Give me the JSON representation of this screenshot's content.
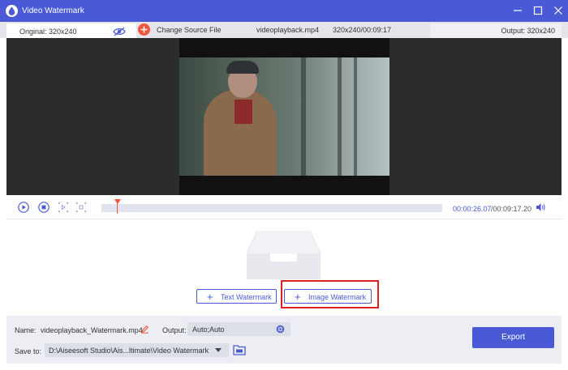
{
  "window": {
    "title": "Video Watermark",
    "controls": [
      "minimize-icon",
      "maximize-icon",
      "close-icon"
    ]
  },
  "infobar": {
    "original": "Original: 320x240",
    "change_source": "Change Source File",
    "filename": "videoplayback.mp4",
    "resolution_duration": "320x240/00:09:17",
    "output": "Output: 320x240"
  },
  "player": {
    "current_time": "00:00:26.07",
    "total_time": "/00:09:17.20",
    "progress_fraction": 0.047,
    "icons": [
      "play-icon",
      "stop-icon",
      "clip-start-icon",
      "clip-end-icon",
      "volume-icon"
    ]
  },
  "watermark": {
    "text_button": "Text Watermark",
    "image_button": "Image Watermark",
    "highlighted": "Image Watermark"
  },
  "settings": {
    "name_label": "Name:",
    "name_value": "videoplayback_Watermark.mp4",
    "output_label": "Output:",
    "output_value": "Auto;Auto",
    "save_label": "Save to:",
    "save_value": "D:\\Aiseesoft Studio\\Ais...ltimate\\Video Watermark",
    "export_label": "Export"
  },
  "colors": {
    "accent": "#4a5ad6",
    "orange": "#f0563c",
    "highlight": "#e02020"
  }
}
